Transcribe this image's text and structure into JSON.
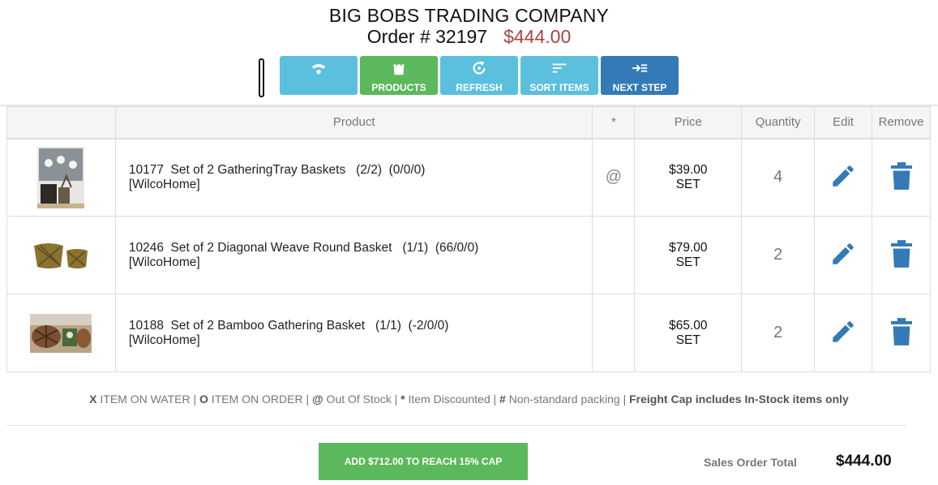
{
  "header": {
    "company": "BIG BOBS TRADING COMPANY",
    "order_label": "Order # 32197",
    "order_amount": "$444.00"
  },
  "toolbar": {
    "buttons": [
      {
        "label": "",
        "icon": "wifi-icon"
      },
      {
        "label": "PRODUCTS",
        "icon": "shopping-bag-icon"
      },
      {
        "label": "REFRESH",
        "icon": "refresh-icon"
      },
      {
        "label": "SORT ITEMS",
        "icon": "sort-icon"
      },
      {
        "label": "NEXT STEP",
        "icon": "next-step-icon"
      }
    ]
  },
  "table": {
    "headers": [
      "",
      "Product",
      "*",
      "Price",
      "Quantity",
      "Edit",
      "Remove"
    ],
    "rows": [
      {
        "line1": "10177  Set of 2 GatheringTray Baskets   (2/2)  (0/0/0)",
        "line2": "[WilcoHome]",
        "flag": "@",
        "price": "$39.00",
        "unit": "SET",
        "quantity": "4"
      },
      {
        "line1": "10246  Set of 2 Diagonal Weave Round Basket   (1/1)  (66/0/0)",
        "line2": "[WilcoHome]",
        "flag": "",
        "price": "$79.00",
        "unit": "SET",
        "quantity": "2"
      },
      {
        "line1": "10188  Set of 2 Bamboo Gathering Basket   (1/1)  (-2/0/0)",
        "line2": "[WilcoHome]",
        "flag": "",
        "price": "$65.00",
        "unit": "SET",
        "quantity": "2"
      }
    ]
  },
  "legend": {
    "x_key": "X",
    "x_text": " ITEM ON WATER | ",
    "o_key": "O",
    "o_text": " ITEM ON ORDER | ",
    "at_key": "@",
    "at_text": " Out Of Stock | ",
    "star_key": "*",
    "star_text": " Item Discounted | ",
    "hash_key": "#",
    "hash_text": " Non-standard packing | ",
    "freight": "Freight Cap includes In-Stock items only"
  },
  "footer": {
    "cap_button": "ADD $712.00 TO REACH 15% CAP",
    "total_label": "Sales Order Total",
    "total_value": "$444.00"
  },
  "colors": {
    "light_button": "#5bc0de",
    "green_button": "#5cb85c",
    "dark_button": "#337ab7",
    "order_amount": "#a94442",
    "action_icon": "#337ab7"
  }
}
